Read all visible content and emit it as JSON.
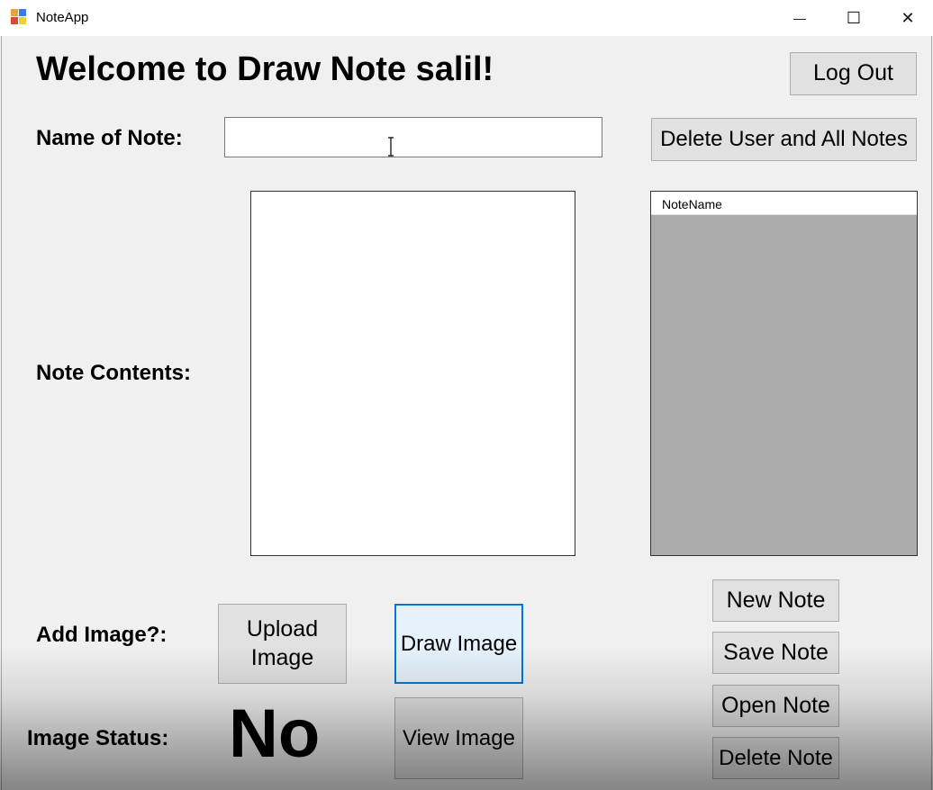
{
  "window": {
    "title": "NoteApp",
    "controls": {
      "minimize": "—",
      "maximize": "☐",
      "close": "✕"
    }
  },
  "header": {
    "welcome": "Welcome to Draw Note salil!",
    "logout_label": "Log Out",
    "delete_user_label": "Delete User and All Notes"
  },
  "form": {
    "name_label": "Name of Note:",
    "name_value": "",
    "contents_label": "Note Contents:",
    "contents_value": "",
    "add_image_label": "Add Image?:",
    "upload_label": "Upload Image",
    "draw_label": "Draw Image",
    "view_label": "View Image",
    "image_status_label": "Image Status:",
    "image_status_value": "No"
  },
  "notes_list": {
    "column_header": "NoteName",
    "rows": []
  },
  "actions": {
    "new_note": "New Note",
    "save_note": "Save Note",
    "open_note": "Open Note",
    "delete_note": "Delete Note"
  },
  "colors": {
    "window_bg": "#f0f0f0",
    "button_bg": "#e1e1e1",
    "focus_border": "#0078d7",
    "listview_bg": "#ababab"
  }
}
